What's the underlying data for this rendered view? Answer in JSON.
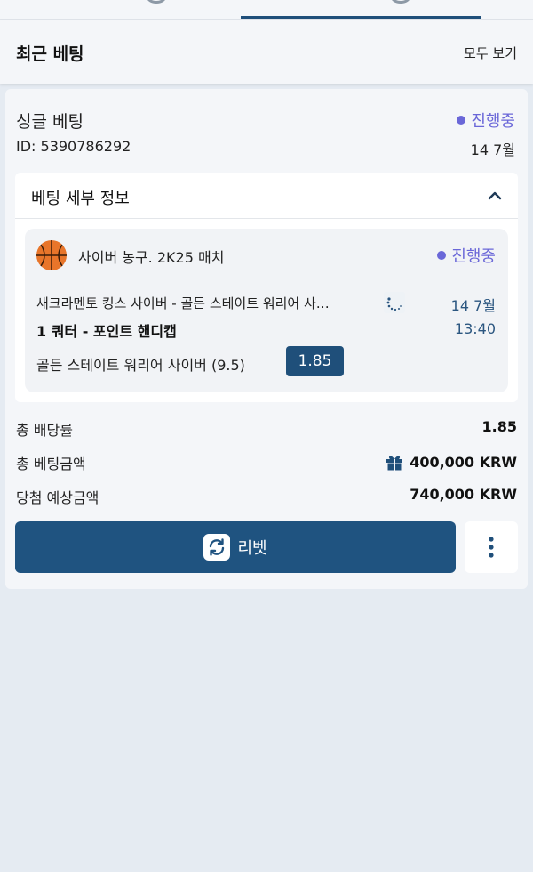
{
  "header": {
    "section_title": "최근 베팅",
    "view_all_label": "모두 보기"
  },
  "bet": {
    "type": "싱글 베팅",
    "status": "진행중",
    "id_label": "ID: 5390786292",
    "date": "14 7월"
  },
  "details": {
    "title": "베팅 세부 정보",
    "match_name": "사이버 농구. 2K25 매치",
    "status": "진행중",
    "teams": "새크라멘토 킹스 사이버 - 골든 스테이트 워리어 사…",
    "match_date": "14 7월",
    "market": "1 쿼터 - 포인트 핸디캡",
    "match_time": "13:40",
    "selection": "골든 스테이트 워리어 사이버 (9.5)",
    "odds": "1.85"
  },
  "summary": {
    "total_odds_label": "총 배당률",
    "total_odds_value": "1.85",
    "total_stake_label": "총 베팅금액",
    "total_stake_value": "400,000 KRW",
    "potential_win_label": "당첨 예상금액",
    "potential_win_value": "740,000 KRW"
  },
  "actions": {
    "rebet_label": "리벳"
  },
  "colors": {
    "accent": "#1f4f7a",
    "status": "#6a67d8",
    "background": "#e5ebf2"
  },
  "icons": [
    "basketball-icon",
    "loading-icon",
    "chevron-up-icon",
    "gift-icon",
    "refresh-icon",
    "more-vertical-icon"
  ]
}
